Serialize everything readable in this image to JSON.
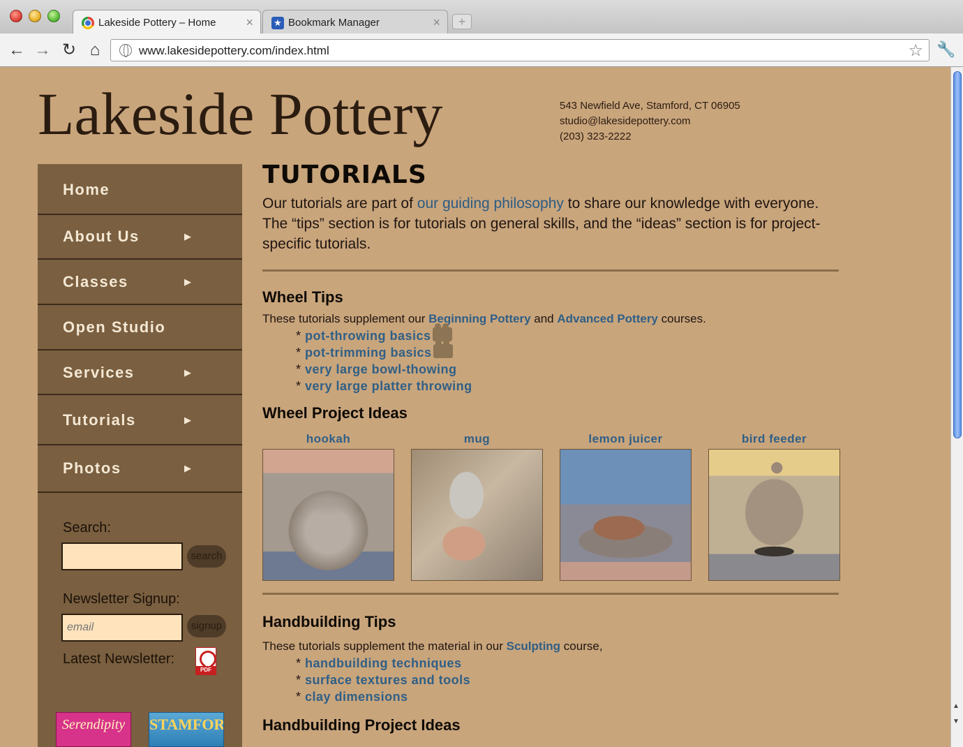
{
  "browser": {
    "tabs": [
      {
        "title": "Lakeside Pottery – Home",
        "active": true
      },
      {
        "title": "Bookmark Manager",
        "active": false
      }
    ],
    "url": "www.lakesidepottery.com/index.html"
  },
  "site": {
    "title": "Lakeside Pottery",
    "contact": {
      "address": "543 Newfield Ave, Stamford, CT 06905",
      "email": "studio@lakesidepottery.com",
      "phone": "(203) 323-2222"
    }
  },
  "sidebar": {
    "menu": [
      {
        "label": "Home",
        "has_submenu": false
      },
      {
        "label": "About Us",
        "has_submenu": true
      },
      {
        "label": "Classes",
        "has_submenu": true
      },
      {
        "label": "Open Studio",
        "has_submenu": false
      },
      {
        "label": "Services",
        "has_submenu": true
      },
      {
        "label": "Tutorials",
        "has_submenu": true
      },
      {
        "label": "Photos",
        "has_submenu": true
      }
    ],
    "search_label": "Search:",
    "search_value": "",
    "search_button": "search",
    "newsletter_label": "Newsletter Signup:",
    "email_placeholder": "email",
    "signup_button": "signup",
    "latest_label": "Latest Newsletter:",
    "pdf_text": "PDF",
    "badges": [
      "Serendipity",
      "STAMFORD"
    ]
  },
  "main": {
    "heading": "TUTORIALS",
    "intro_before": "Our tutorials are part of ",
    "intro_link": "our guiding philosophy",
    "intro_after": " to share our knowledge with everyone.  The “tips” section is for tutorials on general skills, and the “ideas” section is for project-specific tutorials.",
    "wheel_tips": {
      "title": "Wheel Tips",
      "desc_before": "These tutorials supplement our ",
      "link1": "Beginning Pottery",
      "desc_mid": " and ",
      "link2": "Advanced Pottery",
      "desc_after": " courses.",
      "items": [
        "pot-throwing basics",
        "pot-trimming basics",
        "very large bowl-thowing",
        "very large platter throwing"
      ]
    },
    "wheel_projects": {
      "title": "Wheel Project Ideas",
      "items": [
        "hookah",
        "mug",
        "lemon juicer",
        "bird feeder"
      ]
    },
    "hand_tips": {
      "title": "Handbuilding Tips",
      "desc_before": "These tutorials supplement the material in our ",
      "link": "Sculpting",
      "desc_after": " course,",
      "items": [
        "handbuilding techniques",
        "surface textures and tools",
        "clay dimensions"
      ]
    },
    "hand_projects": {
      "title": "Handbuilding Project Ideas"
    }
  }
}
